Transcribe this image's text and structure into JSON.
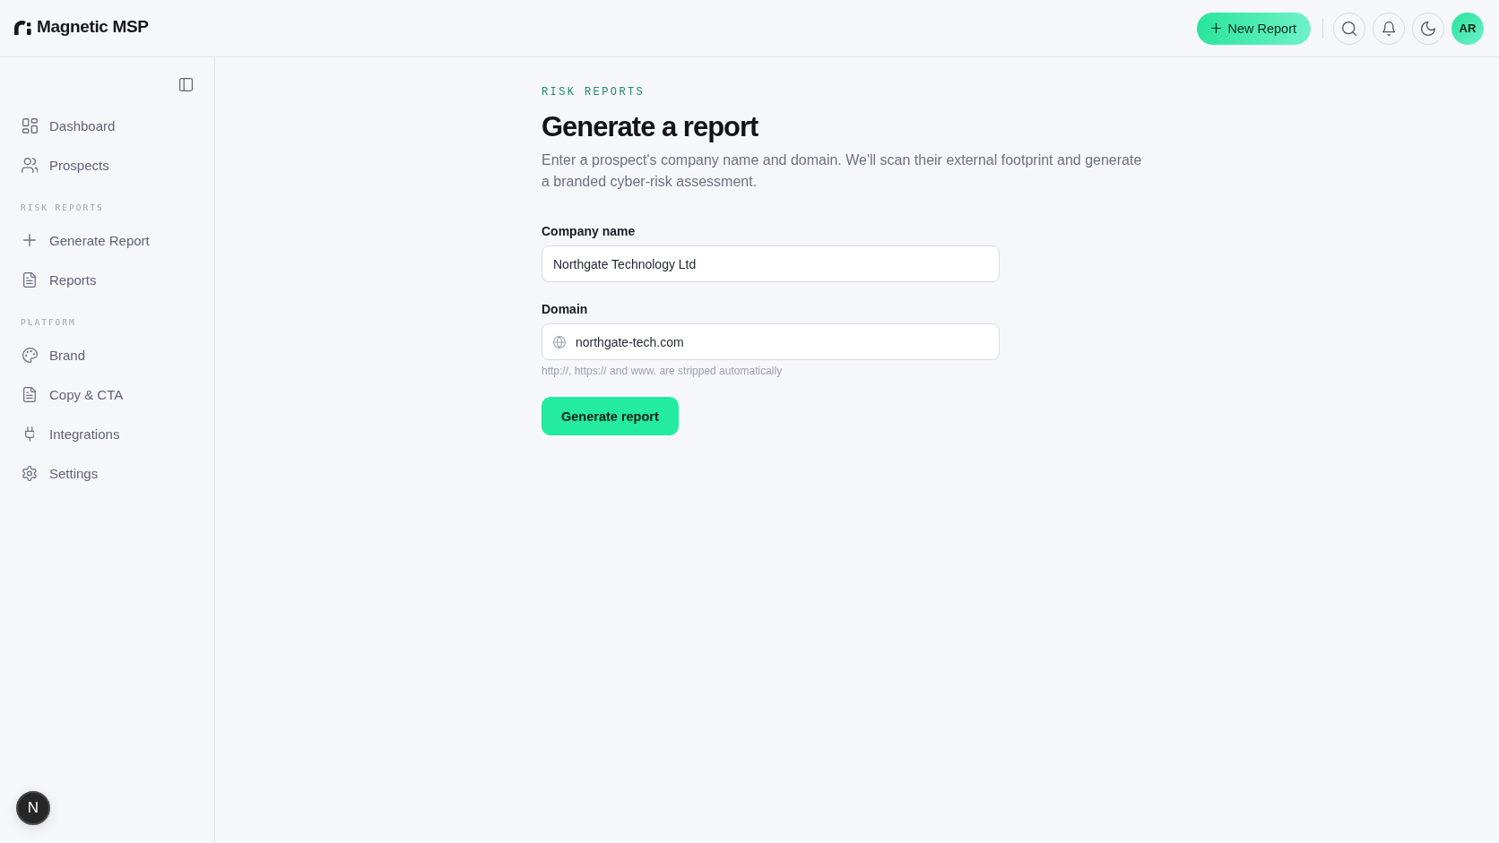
{
  "header": {
    "logo": "Magnetic MSP",
    "new_report_button": "New Report",
    "avatar": "AR"
  },
  "sidebar": {
    "groups": [
      {
        "items": [
          {
            "label": "Dashboard",
            "selected": false
          },
          {
            "label": "Prospects",
            "selected": false
          }
        ]
      },
      {
        "title": "RISK REPORTS",
        "items": [
          {
            "label": "Generate Report",
            "selected": false
          },
          {
            "label": "Reports",
            "selected": false
          }
        ]
      },
      {
        "title": "PLATFORM",
        "items": [
          {
            "label": "Brand",
            "selected": false
          },
          {
            "label": "Copy & CTA",
            "selected": false
          },
          {
            "label": "Integrations",
            "selected": false
          },
          {
            "label": "Settings",
            "selected": false
          }
        ]
      }
    ],
    "dev_badge": "N"
  },
  "main": {
    "eyebrow": "RISK REPORTS",
    "title": "Generate a report",
    "description": "Enter a prospect's company name and domain. We'll scan their external footprint and generate a branded cyber-risk assessment.",
    "fields": [
      {
        "kind": "text",
        "label": "Company name",
        "value": "Northgate Technology Ltd"
      },
      {
        "kind": "domain",
        "label": "Domain",
        "value": "northgate-tech.com",
        "hint": "http://, https:// and www. are stripped automatically"
      }
    ],
    "submit_button": "Generate report"
  }
}
